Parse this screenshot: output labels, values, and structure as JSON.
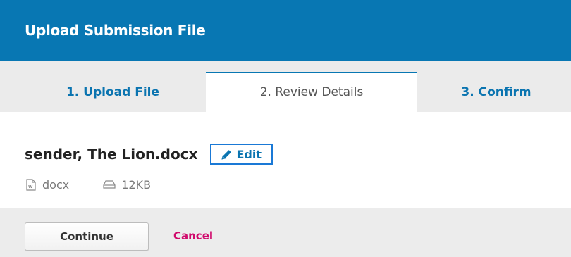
{
  "header": {
    "title": "Upload Submission File",
    "background_color": "#0877b3"
  },
  "tabs": [
    {
      "label": "1. Upload File",
      "active": false
    },
    {
      "label": "2. Review Details",
      "active": true
    },
    {
      "label": "3. Confirm",
      "active": false
    }
  ],
  "file": {
    "name": "sender, The Lion.docx",
    "edit_label": "Edit",
    "edit_icon": "pencil-icon",
    "type": "docx",
    "type_icon": "word-document-icon",
    "size": "12KB",
    "size_icon": "hard-drive-icon"
  },
  "footer": {
    "continue_label": "Continue",
    "cancel_label": "Cancel",
    "cancel_color": "#d00a6c"
  }
}
